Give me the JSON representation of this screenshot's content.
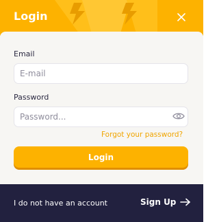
{
  "header": {
    "title": "Login",
    "close_icon": "close-icon",
    "accent_color": "#fdb200"
  },
  "form": {
    "email_label": "Email",
    "email_placeholder": "E-mail",
    "email_value": "",
    "password_label": "Password",
    "password_placeholder": "Password...",
    "password_value": "",
    "toggle_icon": "eye-icon",
    "forgot_link": "Forgot your password?",
    "submit_label": "Login"
  },
  "footer": {
    "prompt": "I do not have an account",
    "signup_label": "Sign Up",
    "signup_icon": "arrow-right-icon",
    "background_color": "#22213f"
  }
}
